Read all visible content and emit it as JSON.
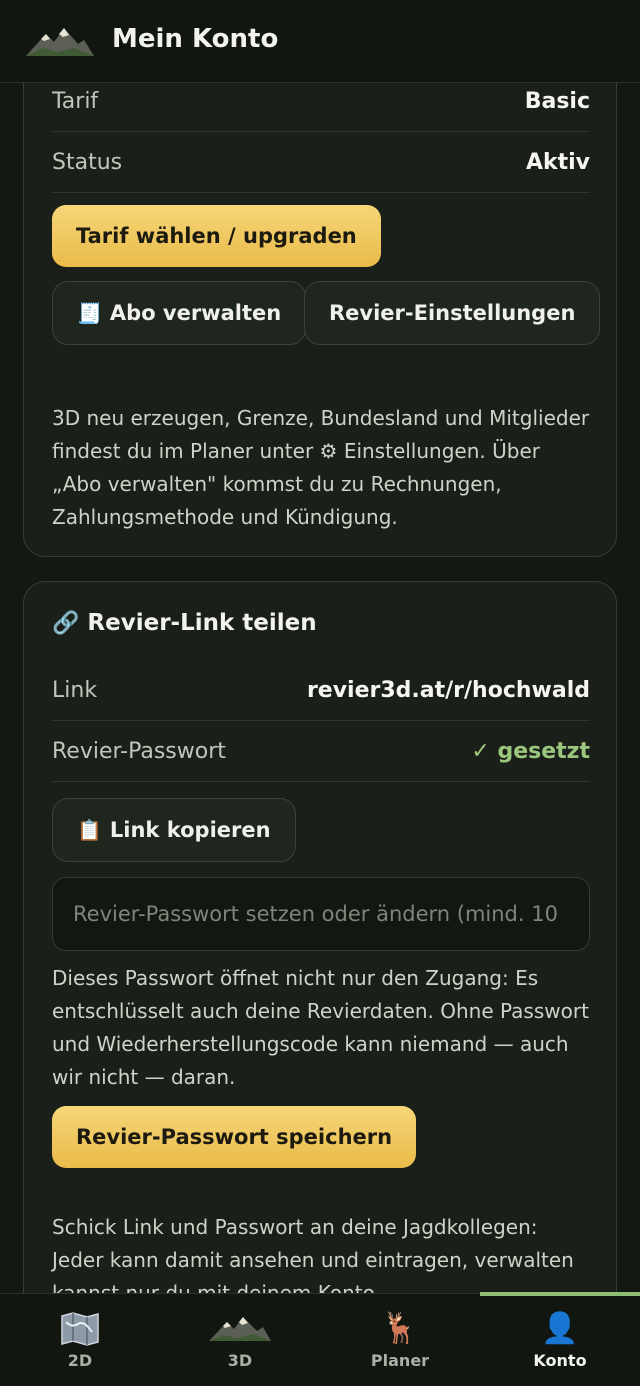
{
  "header": {
    "title": "Mein Konto",
    "logo_icon": "mountain-logo-icon"
  },
  "subscription_card": {
    "rows": [
      {
        "key": "Tarif",
        "value": "Basic"
      },
      {
        "key": "Status",
        "value": "Aktiv"
      }
    ],
    "upgrade_label": "Tarif wählen / upgraden",
    "manage_icon": "🧾",
    "manage_label": "Abo verwalten",
    "settings_label": "Revier-Einstellungen",
    "info_line1": "3D neu erzeugen, Grenze, Bundesland und Mitglieder",
    "info_line2": "findest du im Planer unter ⚙ Einstellungen. Über",
    "info_line3": "„Abo verwalten\" kommst du zu Rechnungen,",
    "info_line4": "Zahlungsmethode und Kündigung."
  },
  "share_card": {
    "title_icon": "🔗",
    "title": "Revier-Link teilen",
    "rows": [
      {
        "key": "Link",
        "value": "revier3d.at/r/hochwald"
      },
      {
        "key": "Revier-Passwort",
        "value": "✓ gesetzt"
      }
    ],
    "copy_icon": "📋",
    "copy_label": "Link kopieren",
    "password_placeholder": "Revier-Passwort setzen oder ändern (mind. 10",
    "password_value": "",
    "warn_line1": "Dieses Passwort öffnet nicht nur den Zugang: Es",
    "warn_line2": "entschlüsselt auch deine Revierdaten. Ohne Passwort",
    "warn_line3": "und Wiederherstellungscode kann niemand — auch",
    "warn_line4": "wir nicht — daran.",
    "save_label": "Revier-Passwort speichern",
    "share_line1": "Schick Link und Passwort an deine Jagdkollegen:",
    "share_line2": "Jeder kann damit ansehen und eintragen, verwalten",
    "share_line3": "kannst nur du mit deinem Konto."
  },
  "tabbar": {
    "active": "Konto",
    "tabs": [
      {
        "label": "2D",
        "icon": "map-icon"
      },
      {
        "label": "3D",
        "icon": "mountain-icon"
      },
      {
        "label": "Planer",
        "icon": "🦌"
      },
      {
        "label": "Konto",
        "icon": "👤"
      }
    ]
  },
  "colors": {
    "accent": "#e9bb49",
    "success": "#9cc77f",
    "background": "#131812"
  }
}
